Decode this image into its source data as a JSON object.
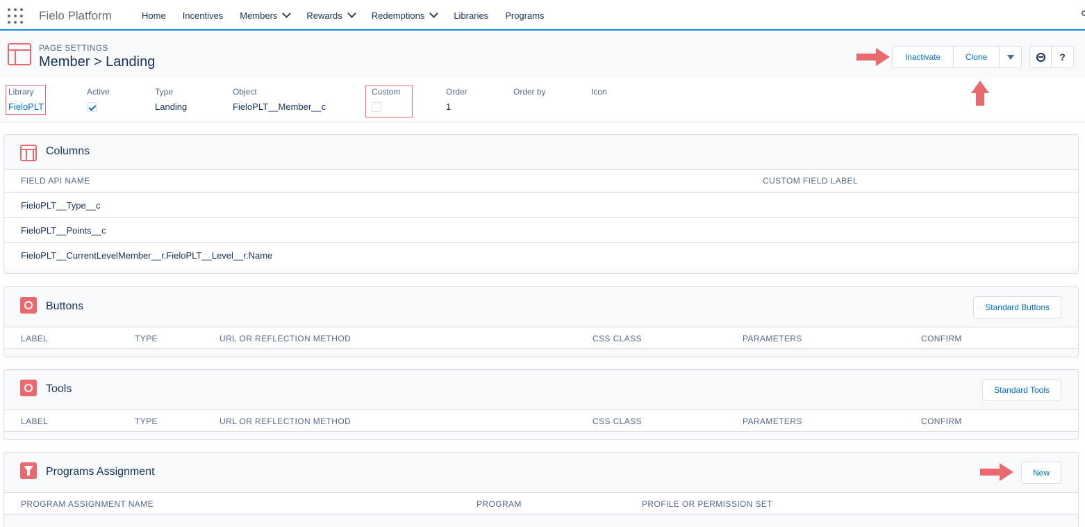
{
  "nav": {
    "app_name": "Fielo Platform",
    "icon": "app-launcher-waffle-icon",
    "items": [
      {
        "label": "Home",
        "dropdown": false
      },
      {
        "label": "Incentives",
        "dropdown": false
      },
      {
        "label": "Members",
        "dropdown": true
      },
      {
        "label": "Rewards",
        "dropdown": true
      },
      {
        "label": "Redemptions",
        "dropdown": true
      },
      {
        "label": "Libraries",
        "dropdown": false
      },
      {
        "label": "Programs",
        "dropdown": false
      }
    ]
  },
  "header": {
    "eyebrow": "PAGE SETTINGS",
    "title": "Member > Landing",
    "buttons": {
      "inactivate": "Inactivate",
      "clone": "Clone",
      "help": "?"
    },
    "fields": {
      "library": {
        "label": "Library",
        "value": "FieloPLT"
      },
      "active": {
        "label": "Active",
        "checked": true
      },
      "type": {
        "label": "Type",
        "value": "Landing"
      },
      "object": {
        "label": "Object",
        "value": "FieloPLT__Member__c"
      },
      "custom": {
        "label": "Custom",
        "checked": false
      },
      "order": {
        "label": "Order",
        "value": "1"
      },
      "order_by": {
        "label": "Order by",
        "value": ""
      },
      "icon": {
        "label": "Icon",
        "value": ""
      }
    }
  },
  "columns": {
    "title": "Columns",
    "headers": [
      "FIELD API NAME",
      "CUSTOM FIELD LABEL"
    ],
    "rows": [
      "FieloPLT__Type__c",
      "FieloPLT__Points__c",
      "FieloPLT__CurrentLevelMember__r.FieloPLT__Level__r.Name"
    ]
  },
  "buttons_section": {
    "title": "Buttons",
    "action": "Standard Buttons",
    "headers": [
      "LABEL",
      "TYPE",
      "URL OR REFLECTION METHOD",
      "CSS CLASS",
      "PARAMETERS",
      "CONFIRM"
    ]
  },
  "tools_section": {
    "title": "Tools",
    "action": "Standard Tools",
    "headers": [
      "LABEL",
      "TYPE",
      "URL OR REFLECTION METHOD",
      "CSS CLASS",
      "PARAMETERS",
      "CONFIRM"
    ]
  },
  "programs_section": {
    "title": "Programs Assignment",
    "action": "New",
    "headers": [
      "PROGRAM ASSIGNMENT NAME",
      "PROGRAM",
      "PROFILE OR PERMISSION SET"
    ]
  },
  "colors": {
    "accent": "#e9696e",
    "link": "#0070d2",
    "text": "#16325c",
    "muted": "#54698d",
    "border": "#d8dde6"
  }
}
